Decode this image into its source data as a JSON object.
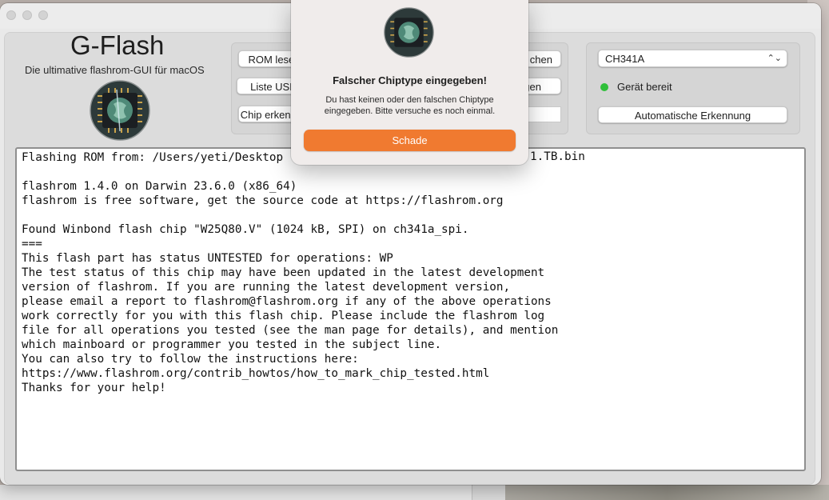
{
  "app": {
    "title": "G-Flash",
    "subtitle": "Die ultimative flashrom-GUI für macOS"
  },
  "actions": {
    "read_rom": "ROM lesen",
    "list_usb": "Liste USB",
    "detect_chip": "Chip erkennen",
    "erase": "chen",
    "write": "gen"
  },
  "device": {
    "programmer_selected": "CH341A",
    "status_text": "Gerät bereit",
    "status_color": "#2fbf3a",
    "auto_detect_label": "Automatische Erkennung"
  },
  "log": {
    "lines": [
      "Flashing ROM from: /Users/yeti/Desktop",
      "",
      "flashrom 1.4.0 on Darwin 23.6.0 (x86_64)",
      "flashrom is free software, get the source code at https://flashrom.org",
      "",
      "Found Winbond flash chip \"W25Q80.V\" (1024 kB, SPI) on ch341a_spi.",
      "===",
      "This flash part has status UNTESTED for operations: WP",
      "The test status of this chip may have been updated in the latest development",
      "version of flashrom. If you are running the latest development version,",
      "please email a report to flashrom@flashrom.org if any of the above operations",
      "work correctly for you with this flash chip. Please include the flashrom log",
      "file for all operations you tested (see the man page for details), and mention",
      "which mainboard or programmer you tested in the subject line.",
      "You can also try to follow the instructions here:",
      "https://www.flashrom.org/contrib_howtos/how_to_mark_chip_tested.html",
      "Thanks for your help!"
    ],
    "line1_tail": "1.TB.bin"
  },
  "alert": {
    "title": "Falscher Chiptype eingegeben!",
    "message": "Du hast keinen oder den falschen Chiptype eingegeben. Bitte versuche es noch einmal.",
    "button_label": "Schade",
    "accent_color": "#f07a30"
  }
}
